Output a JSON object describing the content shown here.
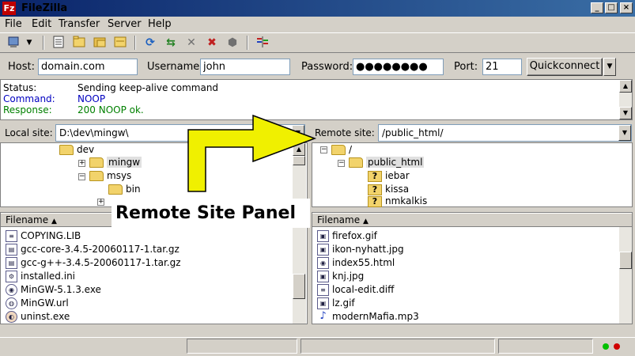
{
  "window": {
    "title": "FileZilla",
    "app_icon": "Fz"
  },
  "menu": [
    "File",
    "Edit",
    "Transfer",
    "Server",
    "Help"
  ],
  "quickconnect": {
    "host_label": "Host:",
    "host_value": "domain.com",
    "username_label": "Username:",
    "username_value": "john",
    "password_label": "Password:",
    "password_value": "●●●●●●●●",
    "port_label": "Port:",
    "port_value": "21",
    "button_label": "Quickconnect"
  },
  "log": [
    {
      "label": "Status:",
      "text": "Sending keep-alive command",
      "color": "#000000"
    },
    {
      "label": "Command:",
      "text": "NOOP",
      "color": "#0000c0"
    },
    {
      "label": "Response:",
      "text": "200 NOOP ok.",
      "color": "#008000"
    }
  ],
  "local": {
    "site_label": "Local site:",
    "site_path": "D:\\dev\\mingw\\",
    "tree": [
      "dev",
      "mingw",
      "msys",
      "bin"
    ],
    "column_header": "Filename",
    "files": [
      "COPYING.LIB",
      "gcc-core-3.4.5-20060117-1.tar.gz",
      "gcc-g++-3.4.5-20060117-1.tar.gz",
      "installed.ini",
      "MinGW-5.1.3.exe",
      "MinGW.url",
      "uninst.exe"
    ]
  },
  "remote": {
    "site_label": "Remote site:",
    "site_path": "/public_html/",
    "tree": [
      "/",
      "public_html",
      "iebar",
      "kissa",
      "nmkalkis"
    ],
    "column_header": "Filename",
    "files": [
      "firefox.gif",
      "ikon-nyhatt.jpg",
      "index55.html",
      "knj.jpg",
      "local-edit.diff",
      "lz.gif",
      "modernMafia.mp3"
    ]
  },
  "annotation": {
    "text": "Remote Site Panel",
    "arrow_color": "#f0f000"
  },
  "colors": {
    "titlebar": "#0a246a",
    "folder": "#f2d36b",
    "led_green": "#00c000",
    "led_red": "#d00000"
  },
  "icons": {
    "toolbar": [
      "site-manager-icon",
      "toggle-log-icon",
      "toggle-local-tree-icon",
      "toggle-remote-tree-icon",
      "toggle-queue-icon",
      "refresh-icon",
      "process-queue-icon",
      "cancel-icon",
      "disconnect-icon",
      "reconnect-icon",
      "compare-icon"
    ]
  }
}
